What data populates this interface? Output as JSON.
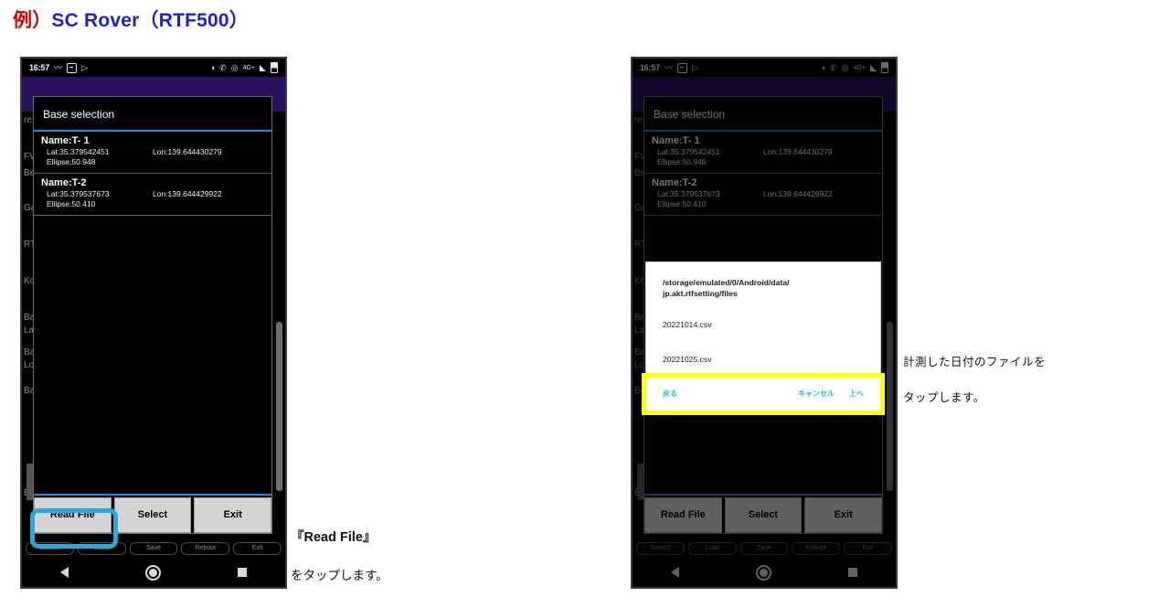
{
  "title": {
    "prefix": "例）",
    "main": "SC Rover（RTF500）"
  },
  "statusbar": {
    "time": "16:57",
    "network": "4G+",
    "icons": [
      "wave-icon",
      "screenshot-icon",
      "play-store-icon",
      "dnd-icon",
      "vibrate-icon",
      "alarm-icon",
      "signal-icon",
      "battery-icon"
    ]
  },
  "base_dialog": {
    "title": "Base selection",
    "items": [
      {
        "name": "Name:T- 1",
        "lat": "Lat:35.379542451",
        "lon": "Lon:139.644430279",
        "ellipse": "Ellipse:50.948"
      },
      {
        "name": "Name:T-2",
        "lat": "Lat:35.379537673",
        "lon": "Lon:139.644429922",
        "ellipse": "Ellipse:50.410"
      }
    ],
    "buttons": [
      "Read File",
      "Select",
      "Exit"
    ]
  },
  "sub_buttons": [
    "Search",
    "Load",
    "Save",
    "Reboot",
    "Exit"
  ],
  "background_labels": [
    "re",
    "FV",
    "Be",
    "Ga",
    "RT",
    "Ko",
    "Ba",
    "La",
    "Ba",
    "Lo",
    "Ba",
    "Ba"
  ],
  "file_picker": {
    "path_line1": "/storage/emulated/0/Android/data/",
    "path_line2": "jp.akt.rtfsetting/files",
    "files": [
      "20221014.csv",
      "20221025.csv"
    ],
    "actions": {
      "back": "戻る",
      "cancel": "キャンセル",
      "up": "上へ"
    }
  },
  "captions": {
    "left_line1": "『Read File』",
    "left_line2": "をタップします。",
    "right_line1": "計測した日付のファイルを",
    "right_line2": "タップします。"
  },
  "colors": {
    "highlight_blue": "#29a8e0",
    "highlight_yellow": "#ffff00",
    "accent_blue": "#1e88e5",
    "title_red": "#d40000",
    "title_blue": "#2020c8",
    "link_cyan": "#22c0cd",
    "purple_band": "#2b1060"
  }
}
